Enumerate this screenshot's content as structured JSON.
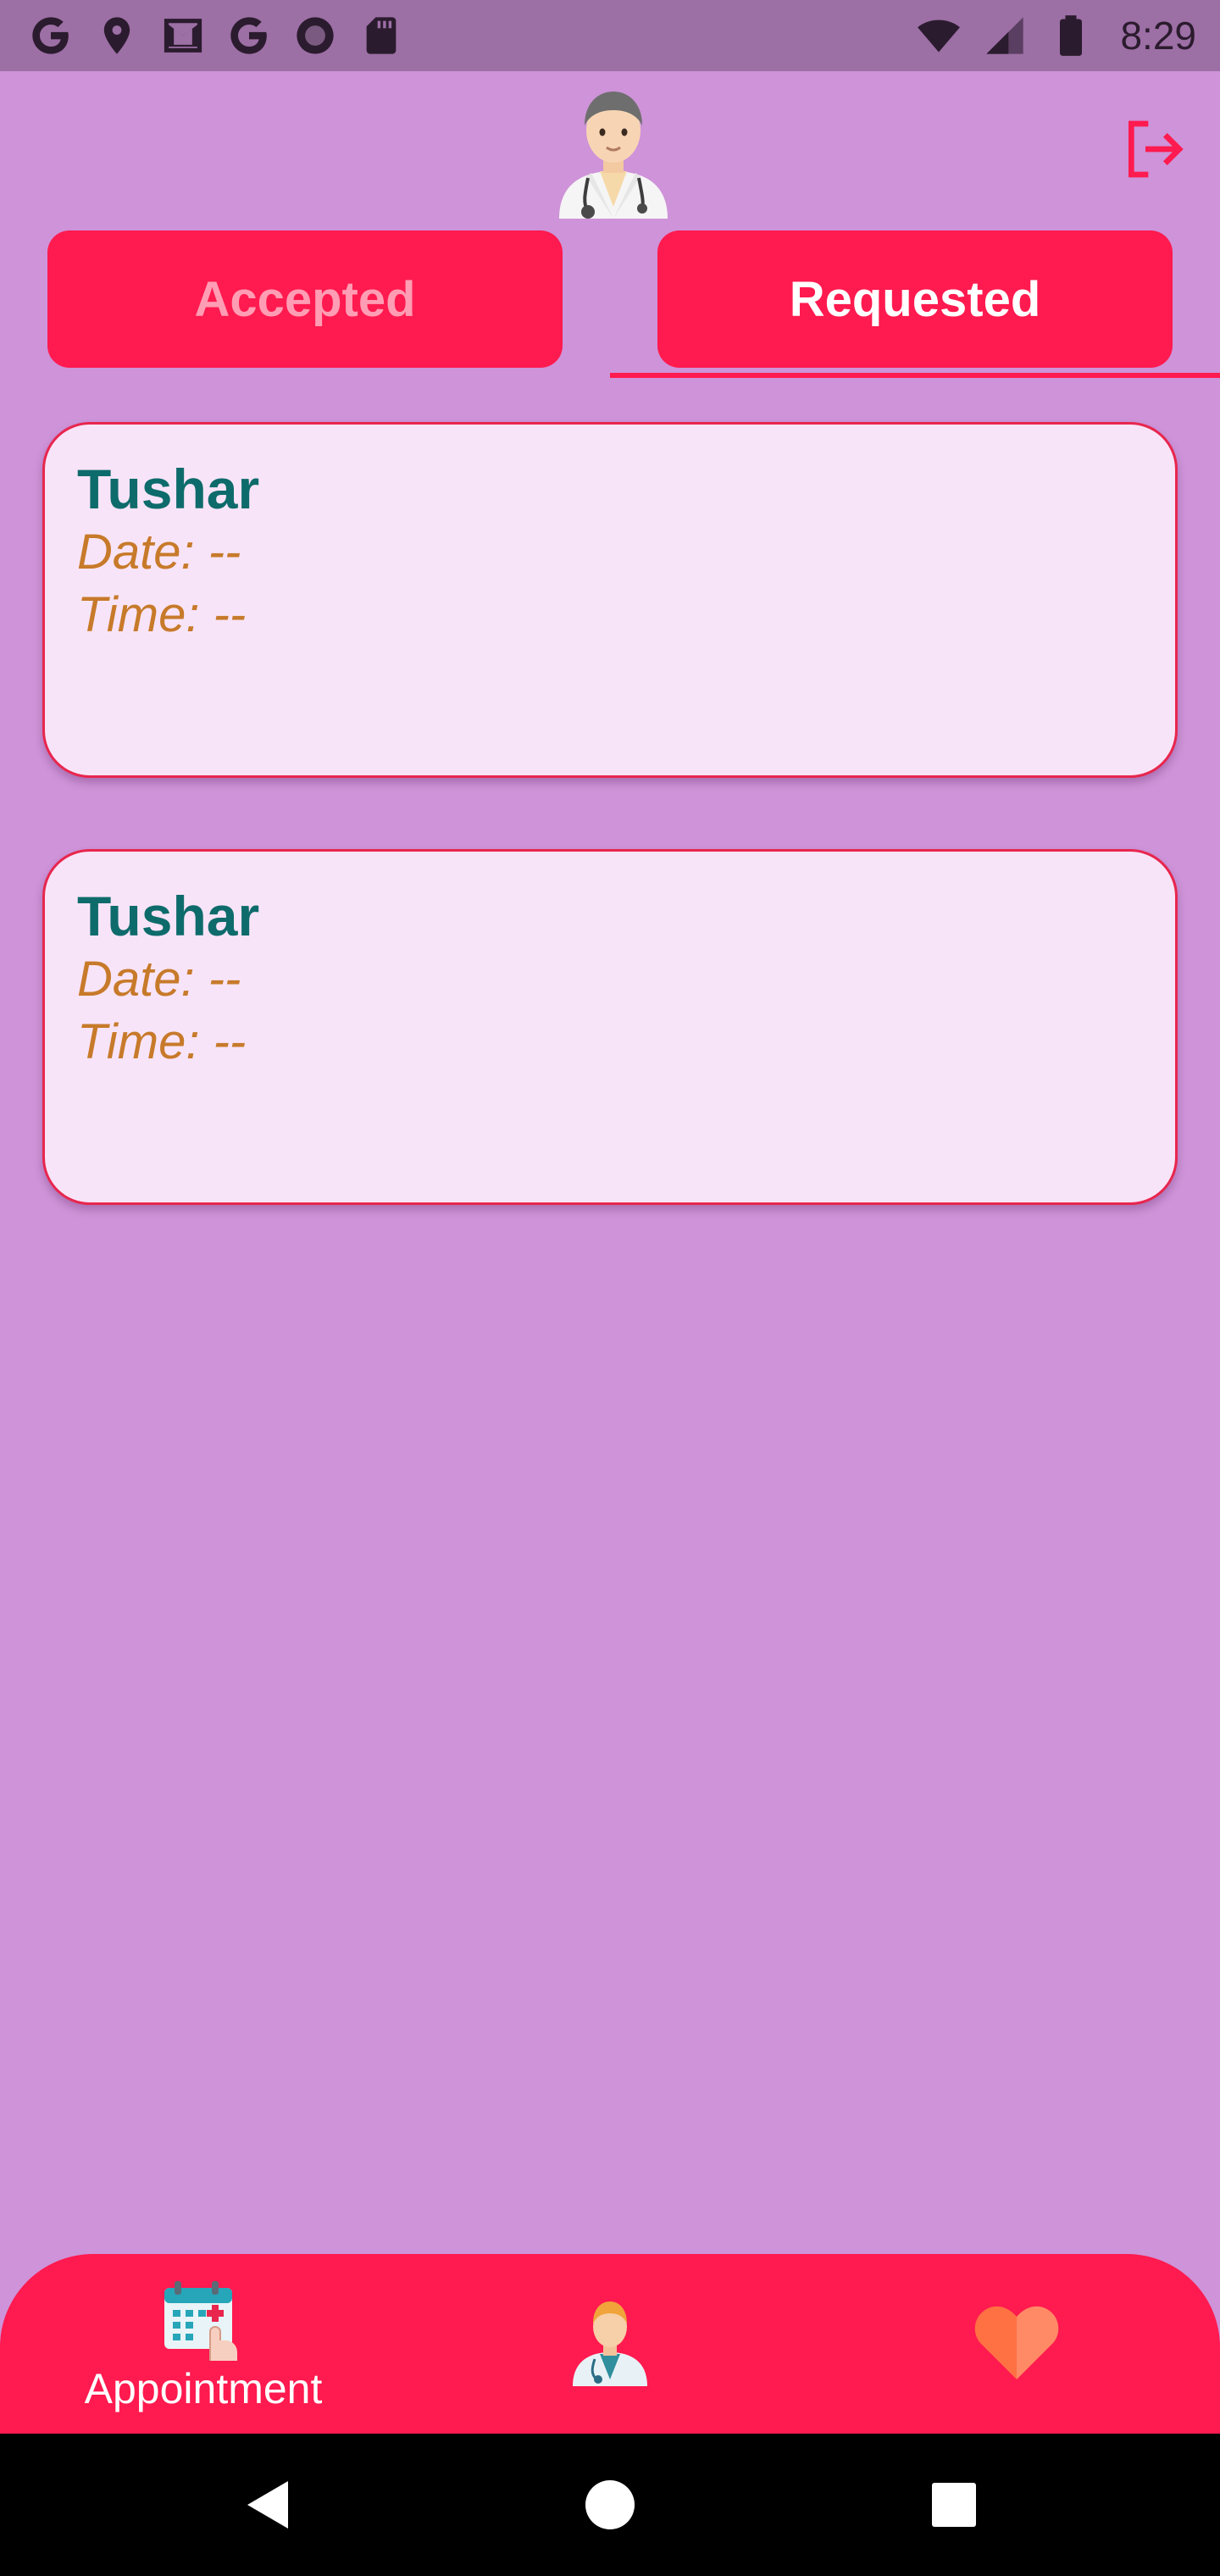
{
  "status_bar": {
    "time": "8:29",
    "icons": [
      "google-icon",
      "location-pin-icon",
      "gmail-icon",
      "google-icon",
      "record-icon",
      "sd-card-icon",
      "wifi-icon",
      "cellular-signal-icon",
      "battery-icon"
    ]
  },
  "header": {
    "avatar": "doctor-avatar-icon",
    "logout_icon": "logout-icon"
  },
  "tabs": [
    {
      "label": "Accepted",
      "selected": false
    },
    {
      "label": "Requested",
      "selected": true
    }
  ],
  "appointments": [
    {
      "name": "Tushar",
      "date": "Date: --",
      "time": "Time: --"
    },
    {
      "name": "Tushar",
      "date": "Date: --",
      "time": "Time: --"
    }
  ],
  "bottom_nav": {
    "items": [
      {
        "label": "Appointment",
        "icon": "calendar-appointment-icon"
      },
      {
        "label": "",
        "icon": "doctor-icon"
      },
      {
        "label": "",
        "icon": "heart-icon"
      }
    ]
  },
  "colors": {
    "background": "#ce93d8",
    "status_bar": "#9c6fa5",
    "accent": "#ff1a4f",
    "card_background": "#f8e4f8",
    "name_text": "#0e6b6b",
    "detail_text": "#c77a2a"
  },
  "system_nav": [
    "back-icon",
    "home-icon",
    "recents-icon"
  ]
}
